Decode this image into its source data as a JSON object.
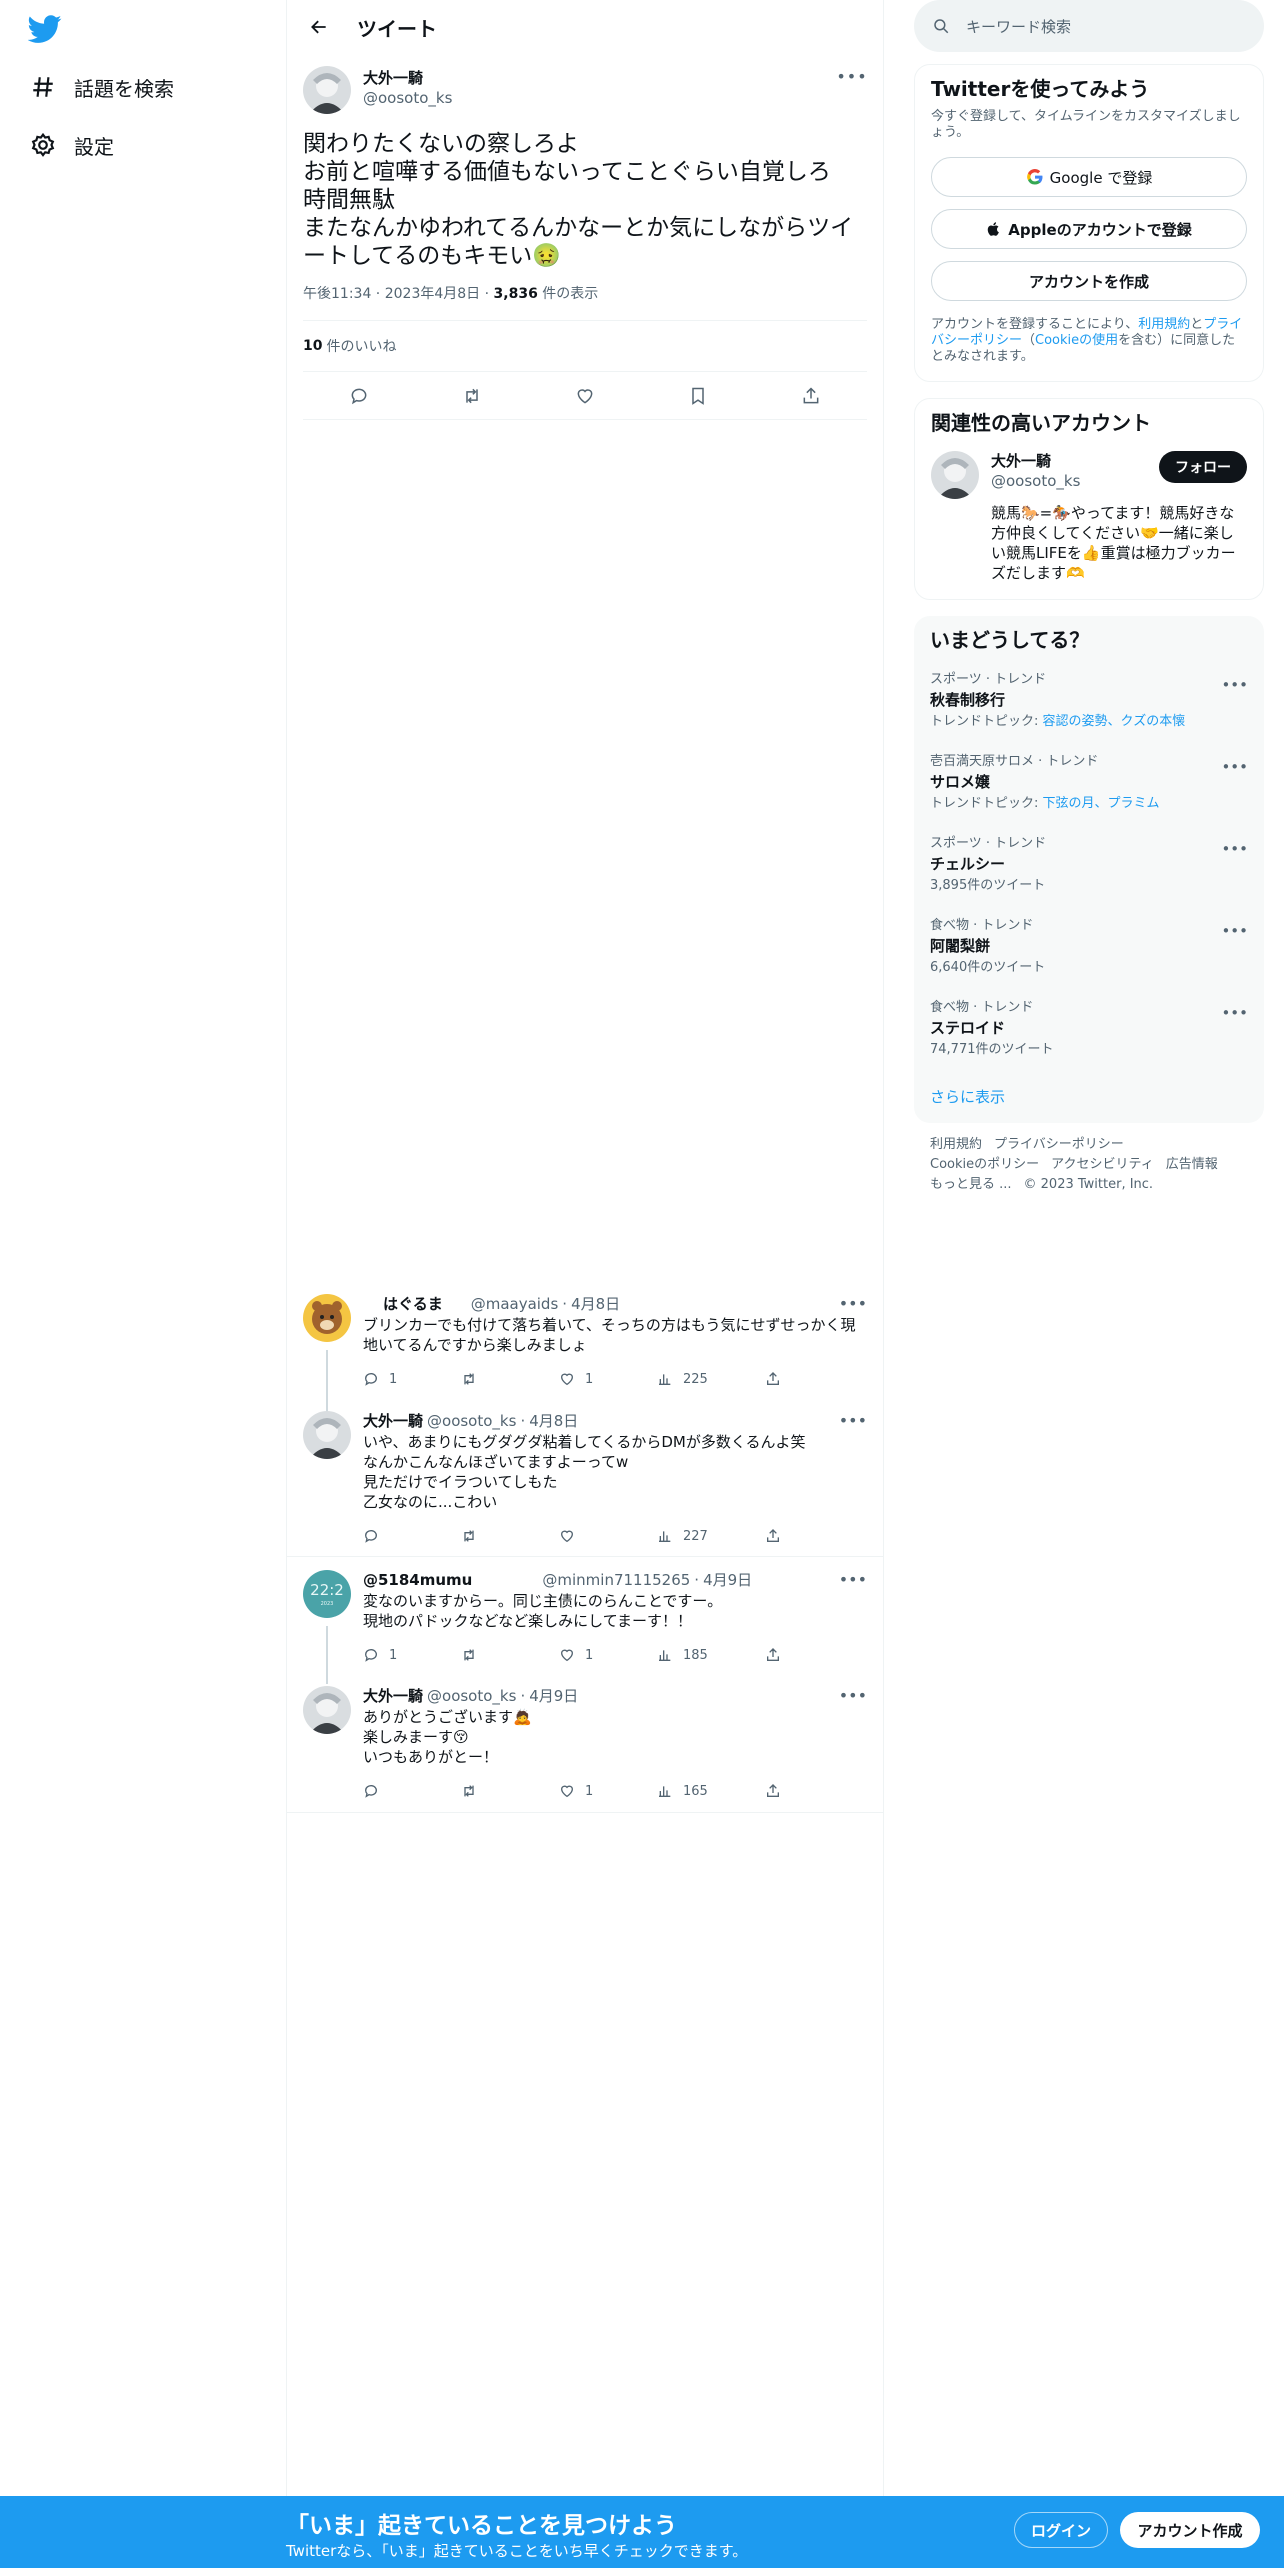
{
  "nav": {
    "items": [
      {
        "label": "話題を検索",
        "icon": "hashtag-icon"
      },
      {
        "label": "設定",
        "icon": "gear-icon"
      }
    ]
  },
  "header": {
    "title": "ツイート"
  },
  "main_tweet": {
    "name": "大外一騎",
    "handle": "@oosoto_ks",
    "text": "関わりたくないの察しろよ\nお前と喧嘩する価値もないってことぐらい自覚しろ\n時間無駄\nまたなんかゆわれてるんかなーとか気にしながらツイートしてるのもキモい🤢",
    "time": "午後11:34",
    "date": "2023年4月8日",
    "views": "3,836",
    "views_suffix": "件の表示",
    "likes": "10",
    "likes_suffix": "件のいいね"
  },
  "replies": [
    {
      "name": "はぐるま",
      "handle": "@maayaids",
      "date": "4月8日",
      "text": "ブリンカーでも付けて落ち着いて、そっちの方はもう気にせずせっかく現地いてるんですから楽しみましょ",
      "replies": "1",
      "retweets": "",
      "likes": "1",
      "views": "225"
    },
    {
      "name": "大外一騎",
      "handle": "@oosoto_ks",
      "date": "4月8日",
      "text": "いや、あまりにもグダグダ粘着してくるからDMが多数くるんよ笑\nなんかこんなんほざいてますよーってw\n見ただけでイラついてしもた\n乙女なのに...こわい",
      "replies": "",
      "retweets": "",
      "likes": "",
      "views": "227"
    },
    {
      "name": "@5184mumu",
      "handle": "@minmin71115265",
      "date": "4月9日",
      "text": "変なのいますからー。同じ主债にのらんことですー。\n現地のパドックなどなど楽しみにしてまーす！！",
      "replies": "1",
      "retweets": "",
      "likes": "1",
      "views": "185"
    },
    {
      "name": "大外一騎",
      "handle": "@oosoto_ks",
      "date": "4月9日",
      "text": "ありがとうございます🙇\n楽しみまーす😚\nいつもありがとー！",
      "replies": "",
      "retweets": "",
      "likes": "1",
      "views": "165"
    }
  ],
  "search": {
    "placeholder": "キーワード検索"
  },
  "signup": {
    "title": "Twitterを使ってみよう",
    "subtitle": "今すぐ登録して、タイムラインをカスタマイズしましょう。",
    "google": "Google で登録",
    "apple": "Appleのアカウントで登録",
    "create": "アカウントを作成",
    "legal_pre": "アカウントを登録することにより、",
    "legal_terms": "利用規約",
    "legal_and": "と",
    "legal_privacy": "プライバシーポリシー",
    "legal_mid": "（",
    "legal_cookie": "Cookieの使用",
    "legal_post": "を含む）に同意したとみなされます。"
  },
  "related": {
    "title": "関連性の高いアカウント",
    "name": "大外一騎",
    "handle": "@oosoto_ks",
    "follow": "フォロー",
    "bio": "競馬🐎=🏇やってます！競馬好きな方仲良くしてください🤝一緒に楽しい競馬LIFEを👍重賞は極力ブッカーズだします🫶"
  },
  "trends": {
    "title": "いまどうしてる？",
    "items": [
      {
        "meta": "スポーツ · トレンド",
        "name": "秋春制移行",
        "sub_prefix": "トレンドトピック: ",
        "sub_links": "容認の姿勢、クズの本懐"
      },
      {
        "meta": "壱百満天原サロメ · トレンド",
        "name": "サロメ嬢",
        "sub_prefix": "トレンドトピック: ",
        "sub_links": "下弦の月、プラミム"
      },
      {
        "meta": "スポーツ · トレンド",
        "name": "チェルシー",
        "sub_prefix": "3,895件のツイート",
        "sub_links": ""
      },
      {
        "meta": "食べ物 · トレンド",
        "name": "阿闍梨餅",
        "sub_prefix": "6,640件のツイート",
        "sub_links": ""
      },
      {
        "meta": "食べ物 · トレンド",
        "name": "ステロイド",
        "sub_prefix": "74,771件のツイート",
        "sub_links": ""
      }
    ],
    "show_more": "さらに表示"
  },
  "footer": {
    "terms": "利用規約",
    "privacy": "プライバシーポリシー",
    "cookie": "Cookieのポリシー",
    "accessibility": "アクセシビリティ",
    "ads": "広告情報",
    "more": "もっと見る ...",
    "copyright": "© 2023 Twitter, Inc."
  },
  "bottombar": {
    "title": "「いま」起きていることを見つけよう",
    "subtitle": "Twitterなら、「いま」起きていることをいち早くチェックできます。",
    "login": "ログイン",
    "signup": "アカウント作成"
  },
  "colors": {
    "accent": "#1d9bf0",
    "text": "#0f1419",
    "muted": "#536471",
    "border": "#eff3f4"
  }
}
